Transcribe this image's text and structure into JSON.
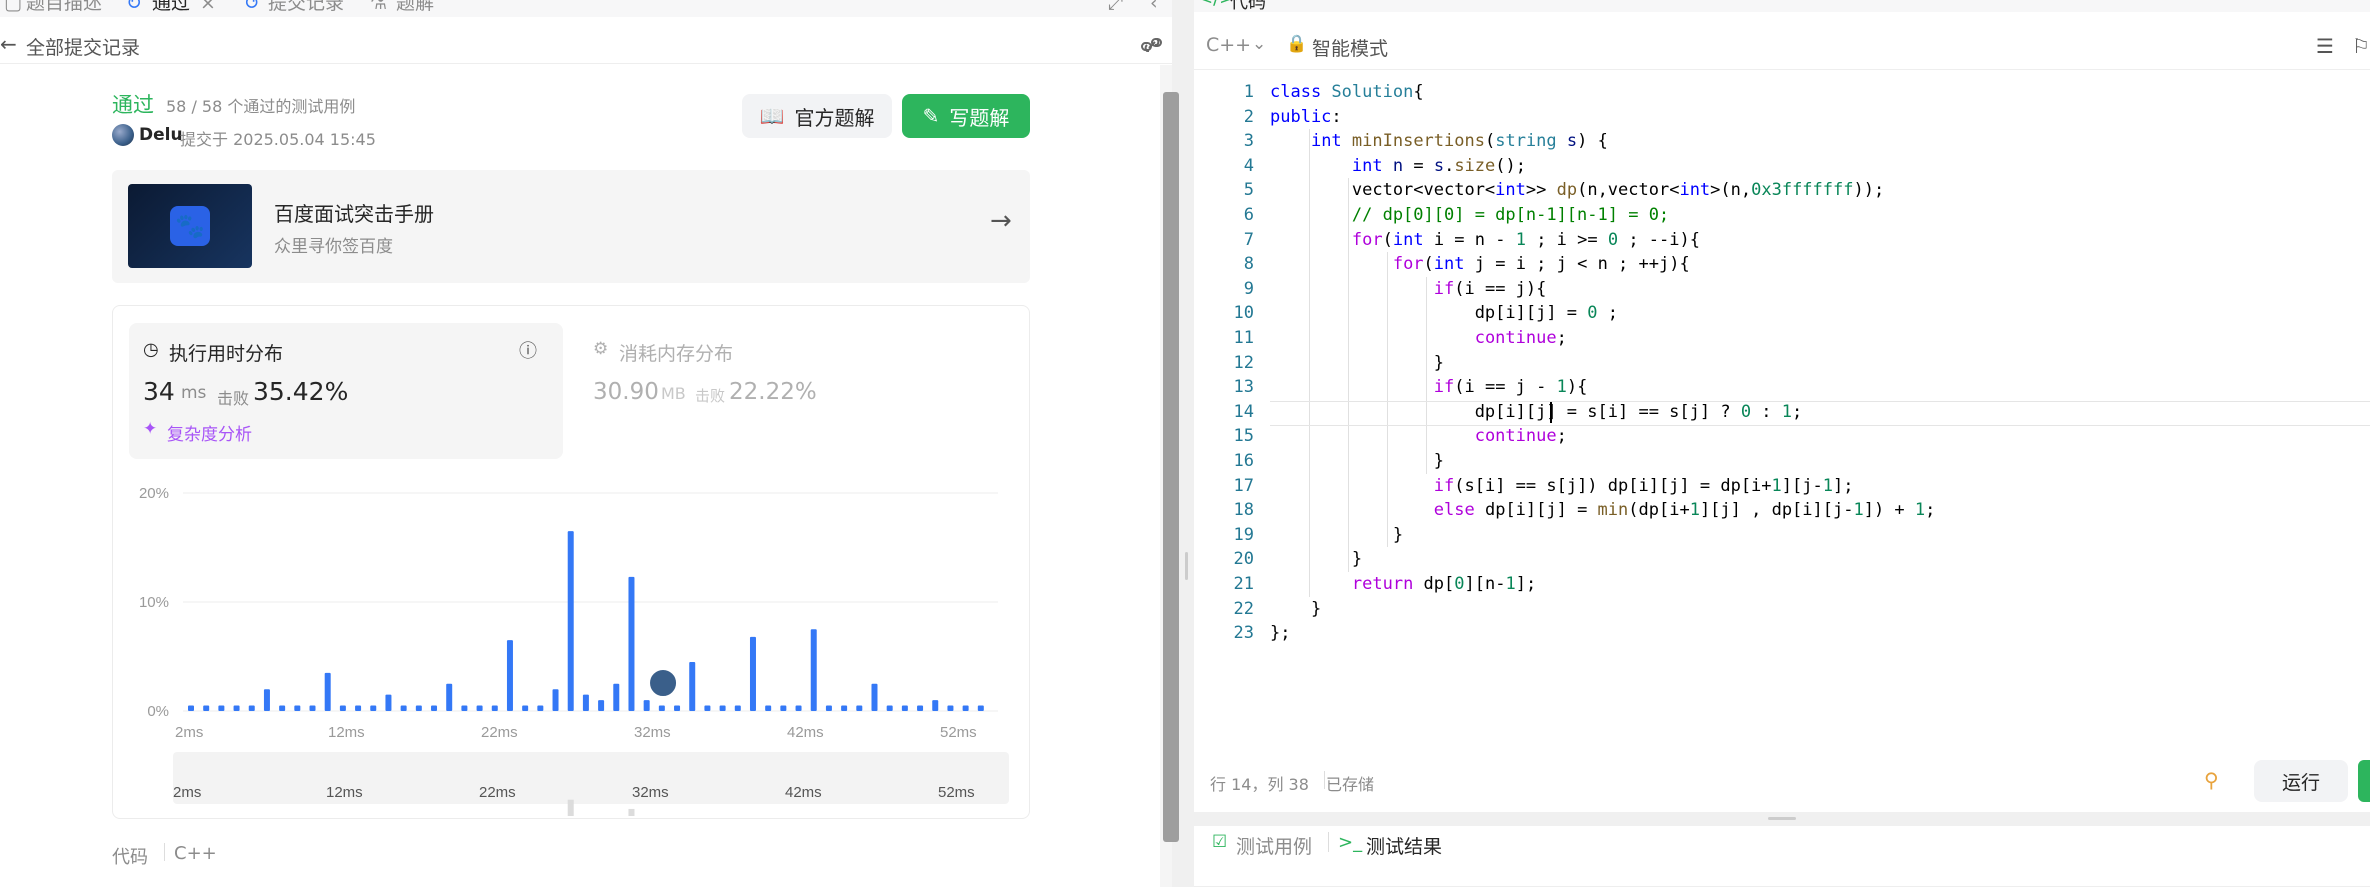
{
  "left_tabs": [
    {
      "label": "题目描述"
    },
    {
      "label": "通过"
    },
    {
      "label": "提交记录"
    },
    {
      "label": "题解"
    }
  ],
  "nav": {
    "back_label": "全部提交记录"
  },
  "submission": {
    "status": "通过",
    "tests": "58 / 58 个通过的测试用例",
    "user": "Delu",
    "submitted_at": "提交于 2025.05.04 15:45",
    "official_btn": "官方题解",
    "write_btn": "写题解"
  },
  "banner": {
    "title": "百度面试突击手册",
    "subtitle": "众里寻你签百度"
  },
  "runtime": {
    "label": "执行用时分布",
    "value": "34",
    "unit": "ms",
    "beat_label": "击败",
    "beat": "35.42%",
    "complexity": "复杂度分析"
  },
  "memory": {
    "label": "消耗内存分布",
    "value": "30.90",
    "unit": "MB",
    "beat_label": "击败",
    "beat": "22.22%"
  },
  "chart_data": {
    "type": "bar",
    "yticks": [
      "20%",
      "10%",
      "0%"
    ],
    "xticks": [
      "2ms",
      "12ms",
      "22ms",
      "32ms",
      "42ms",
      "52ms"
    ],
    "ylim": [
      0,
      20
    ],
    "values": [
      0.5,
      0.5,
      0.5,
      0.5,
      0.5,
      2,
      0.5,
      0.5,
      0.5,
      3.5,
      0.5,
      0.5,
      0.5,
      1.5,
      0.5,
      0.5,
      0.5,
      2.5,
      0.5,
      0.5,
      0.5,
      6.5,
      0.5,
      0.5,
      2,
      16.5,
      1.5,
      1,
      2.5,
      12.3,
      1,
      0.5,
      0.5,
      4.5,
      0.5,
      0.5,
      0.5,
      6.8,
      0.5,
      0.5,
      0.5,
      7.5,
      0.5,
      0.5,
      0.5,
      2.5,
      0.5,
      0.5,
      0.5,
      1,
      0.5,
      0.5,
      0.5
    ],
    "current_index": 32,
    "color": "#3478f6"
  },
  "code_section": {
    "label": "代码",
    "lang": "C++"
  },
  "editor": {
    "title": "代码",
    "lang": "C++",
    "mode": "智能模式",
    "status_pos": "行 14，列 38",
    "saved": "已存储",
    "run": "运行"
  },
  "code_lines": [
    [
      [
        "kw",
        "class "
      ],
      [
        "ty",
        "Solution"
      ],
      [
        "",
        "{"
      ]
    ],
    [
      [
        "kw",
        "public"
      ],
      [
        "",
        ":"
      ]
    ],
    [
      [
        "",
        "    "
      ],
      [
        "kw",
        "int "
      ],
      [
        "fn",
        "minInsertions"
      ],
      [
        "",
        "("
      ],
      [
        "ty",
        "string "
      ],
      [
        "vr",
        "s"
      ],
      [
        "",
        ") {"
      ]
    ],
    [
      [
        "",
        "        "
      ],
      [
        "kw",
        "int "
      ],
      [
        "vr",
        "n"
      ],
      [
        "",
        " = "
      ],
      [
        "vr",
        "s"
      ],
      [
        "",
        "."
      ],
      [
        "fn",
        "size"
      ],
      [
        "",
        "();"
      ]
    ],
    [
      [
        "",
        "        vector<vector<"
      ],
      [
        "kw",
        "int"
      ],
      [
        "",
        ">> "
      ],
      [
        "fn",
        "dp"
      ],
      [
        "",
        "(n,vector<"
      ],
      [
        "kw",
        "int"
      ],
      [
        "",
        ">(n,"
      ],
      [
        "nm",
        "0x3fffffff"
      ],
      [
        "",
        "));"
      ]
    ],
    [
      [
        "cm",
        "        // dp[0][0] = dp[n-1][n-1] = 0;"
      ]
    ],
    [
      [
        "",
        "        "
      ],
      [
        "kc",
        "for"
      ],
      [
        "",
        "("
      ],
      [
        "kw",
        "int "
      ],
      [
        "",
        "i = n - "
      ],
      [
        "nm",
        "1"
      ],
      [
        "",
        " ; i >= "
      ],
      [
        "nm",
        "0"
      ],
      [
        "",
        " ; --i){"
      ]
    ],
    [
      [
        "",
        "            "
      ],
      [
        "kc",
        "for"
      ],
      [
        "",
        "("
      ],
      [
        "kw",
        "int "
      ],
      [
        "",
        "j = i ; j < n ; ++j){"
      ]
    ],
    [
      [
        "",
        "                "
      ],
      [
        "kc",
        "if"
      ],
      [
        "",
        "(i == j){"
      ]
    ],
    [
      [
        "",
        "                    dp[i][j] = "
      ],
      [
        "nm",
        "0"
      ],
      [
        "",
        " ;"
      ]
    ],
    [
      [
        "",
        "                    "
      ],
      [
        "kc",
        "continue"
      ],
      [
        "",
        ";"
      ]
    ],
    [
      [
        "",
        "                }"
      ]
    ],
    [
      [
        "",
        "                "
      ],
      [
        "kc",
        "if"
      ],
      [
        "",
        "(i == j - "
      ],
      [
        "nm",
        "1"
      ],
      [
        "",
        "){"
      ]
    ],
    [
      [
        "",
        "                    dp[i][j] = s[i] == s[j] ? "
      ],
      [
        "nm",
        "0"
      ],
      [
        "",
        " : "
      ],
      [
        "nm",
        "1"
      ],
      [
        "",
        ";"
      ]
    ],
    [
      [
        "",
        "                    "
      ],
      [
        "kc",
        "continue"
      ],
      [
        "",
        ";"
      ]
    ],
    [
      [
        "",
        "                }"
      ]
    ],
    [
      [
        "",
        "                "
      ],
      [
        "kc",
        "if"
      ],
      [
        "",
        "(s[i] == s[j]) dp[i][j] = dp[i+"
      ],
      [
        "nm",
        "1"
      ],
      [
        "",
        "][j-"
      ],
      [
        "nm",
        "1"
      ],
      [
        "",
        "];"
      ]
    ],
    [
      [
        "",
        "                "
      ],
      [
        "kc",
        "else "
      ],
      [
        "",
        "dp[i][j] = "
      ],
      [
        "fn",
        "min"
      ],
      [
        "",
        "(dp[i+"
      ],
      [
        "nm",
        "1"
      ],
      [
        "",
        "][j] , dp[i][j-"
      ],
      [
        "nm",
        "1"
      ],
      [
        "",
        "]) + "
      ],
      [
        "nm",
        "1"
      ],
      [
        "",
        ";"
      ]
    ],
    [
      [
        "",
        "            }"
      ]
    ],
    [
      [
        "",
        "        }"
      ]
    ],
    [
      [
        "",
        "        "
      ],
      [
        "kc",
        "return "
      ],
      [
        "",
        "dp["
      ],
      [
        "nm",
        "0"
      ],
      [
        "",
        "][n-"
      ],
      [
        "nm",
        "1"
      ],
      [
        "",
        "];"
      ]
    ],
    [
      [
        "",
        "    }"
      ]
    ],
    [
      [
        "",
        "};"
      ]
    ]
  ],
  "bottom_tabs": {
    "testcase": "测试用例",
    "result": "测试结果"
  }
}
